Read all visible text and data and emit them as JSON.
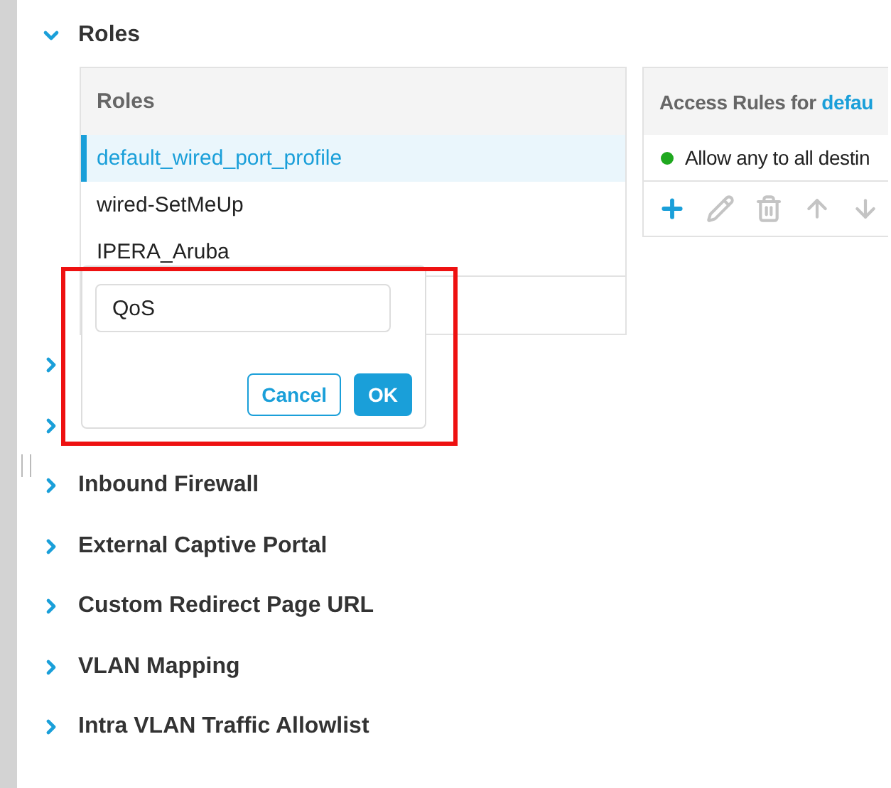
{
  "sections": [
    {
      "title": "Roles",
      "expanded": true
    },
    {
      "expanded": false
    },
    {
      "expanded": false
    },
    {
      "title": "Inbound Firewall",
      "expanded": false
    },
    {
      "title": "External Captive Portal",
      "expanded": false
    },
    {
      "title": "Custom Redirect Page URL",
      "expanded": false
    },
    {
      "title": "VLAN Mapping",
      "expanded": false
    },
    {
      "title": "Intra VLAN Traffic Allowlist",
      "expanded": false
    }
  ],
  "roles_panel": {
    "header": "Roles",
    "items": [
      {
        "label": "default_wired_port_profile",
        "selected": true
      },
      {
        "label": "wired-SetMeUp",
        "selected": false
      },
      {
        "label": "IPERA_Aruba",
        "selected": false
      }
    ]
  },
  "access_rules_panel": {
    "header": "Access Rules for",
    "role": "defau",
    "rules": [
      {
        "label": "Allow any to all destin",
        "color": "#1fa81f"
      }
    ],
    "toolbar": [
      {
        "kind": "add",
        "disabled": false
      },
      {
        "kind": "edit",
        "disabled": true
      },
      {
        "kind": "delete",
        "disabled": true
      },
      {
        "kind": "up",
        "disabled": true
      },
      {
        "kind": "down",
        "disabled": true
      }
    ]
  },
  "new_role_popup": {
    "value": "QoS",
    "buttons": [
      {
        "kind": "secondary",
        "label": "Cancel"
      },
      {
        "kind": "primary",
        "label": "OK"
      }
    ]
  },
  "highlight": true
}
